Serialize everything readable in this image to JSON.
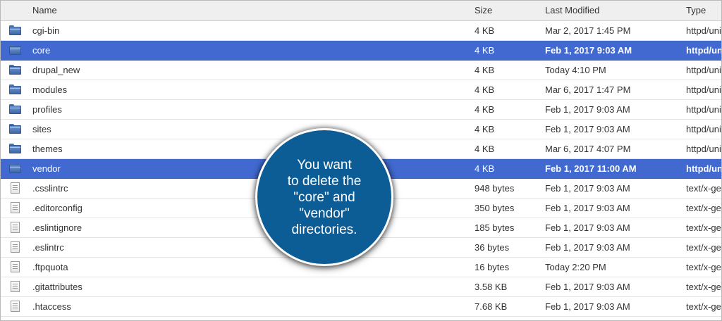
{
  "columns": {
    "name": "Name",
    "size": "Size",
    "modified": "Last Modified",
    "type": "Type"
  },
  "rows": [
    {
      "name": "cgi-bin",
      "size": "4 KB",
      "modified": "Mar 2, 2017 1:45 PM",
      "type": "httpd/unix-directory",
      "kind": "folder-icon",
      "selected": false
    },
    {
      "name": "core",
      "size": "4 KB",
      "modified": "Feb 1, 2017 9:03 AM",
      "type": "httpd/unix-directory",
      "kind": "folder-icon",
      "selected": true
    },
    {
      "name": "drupal_new",
      "size": "4 KB",
      "modified": "Today 4:10 PM",
      "type": "httpd/unix-directory",
      "kind": "folder-icon",
      "selected": false
    },
    {
      "name": "modules",
      "size": "4 KB",
      "modified": "Mar 6, 2017 1:47 PM",
      "type": "httpd/unix-directory",
      "kind": "folder-icon",
      "selected": false
    },
    {
      "name": "profiles",
      "size": "4 KB",
      "modified": "Feb 1, 2017 9:03 AM",
      "type": "httpd/unix-directory",
      "kind": "folder-icon",
      "selected": false
    },
    {
      "name": "sites",
      "size": "4 KB",
      "modified": "Feb 1, 2017 9:03 AM",
      "type": "httpd/unix-directory",
      "kind": "folder-icon",
      "selected": false
    },
    {
      "name": "themes",
      "size": "4 KB",
      "modified": "Mar 6, 2017 4:07 PM",
      "type": "httpd/unix-directory",
      "kind": "folder-icon",
      "selected": false
    },
    {
      "name": "vendor",
      "size": "4 KB",
      "modified": "Feb 1, 2017 11:00 AM",
      "type": "httpd/unix-directory",
      "kind": "folder-icon",
      "selected": true
    },
    {
      "name": ".csslintrc",
      "size": "948 bytes",
      "modified": "Feb 1, 2017 9:03 AM",
      "type": "text/x-generic",
      "kind": "file-icon",
      "selected": false
    },
    {
      "name": ".editorconfig",
      "size": "350 bytes",
      "modified": "Feb 1, 2017 9:03 AM",
      "type": "text/x-generic",
      "kind": "file-icon",
      "selected": false
    },
    {
      "name": ".eslintignore",
      "size": "185 bytes",
      "modified": "Feb 1, 2017 9:03 AM",
      "type": "text/x-generic",
      "kind": "file-icon",
      "selected": false
    },
    {
      "name": ".eslintrc",
      "size": "36 bytes",
      "modified": "Feb 1, 2017 9:03 AM",
      "type": "text/x-generic",
      "kind": "file-icon",
      "selected": false
    },
    {
      "name": ".ftpquota",
      "size": "16 bytes",
      "modified": "Today 2:20 PM",
      "type": "text/x-generic",
      "kind": "file-icon",
      "selected": false
    },
    {
      "name": ".gitattributes",
      "size": "3.58 KB",
      "modified": "Feb 1, 2017 9:03 AM",
      "type": "text/x-generic",
      "kind": "file-icon",
      "selected": false
    },
    {
      "name": ".htaccess",
      "size": "7.68 KB",
      "modified": "Feb 1, 2017 9:03 AM",
      "type": "text/x-generic",
      "kind": "file-icon",
      "selected": false
    }
  ],
  "callout": {
    "text": "You want\nto delete the\n\"core\" and \"vendor\"\ndirectories."
  },
  "colors": {
    "selection": "#4169cf",
    "callout": "#0c5c96",
    "folder": "#4b72ad"
  }
}
